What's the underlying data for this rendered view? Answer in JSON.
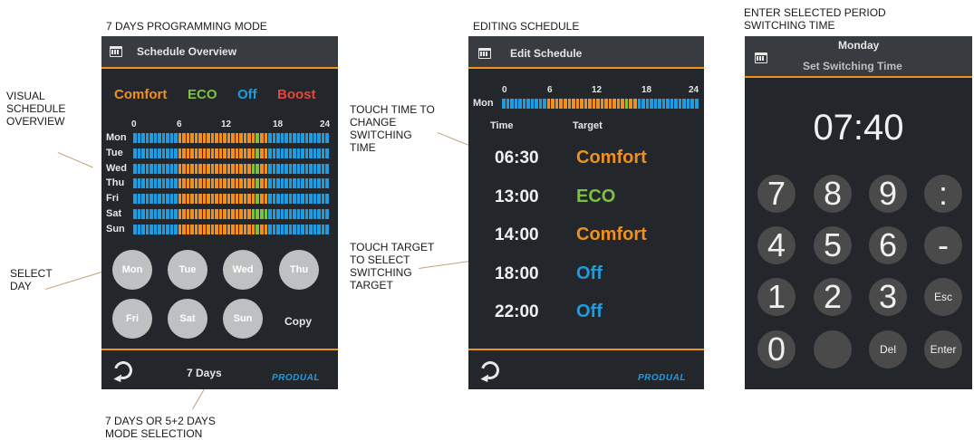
{
  "captions": {
    "mode_title": "7 DAYS PROGRAMMING MODE",
    "visual_overview": "VISUAL\nSCHEDULE\nOVERVIEW",
    "select_day": "SELECT\nDAY",
    "mode_selection": "7 DAYS OR 5+2 DAYS\nMODE SELECTION",
    "editing": "EDITING SCHEDULE",
    "touch_time": "TOUCH TIME TO\nCHANGE\nSWITCHING\nTIME",
    "touch_target": "TOUCH TARGET\nTO SELECT\nSWITCHING\nTARGET",
    "enter_period": "ENTER SELECTED PERIOD\nSWITCHING TIME"
  },
  "colors": {
    "comfort": "#f0901e",
    "eco": "#7cc242",
    "off": "#1e9ce0",
    "boost": "#e8443a"
  },
  "screen1": {
    "header_title": "Schedule Overview",
    "icon": "calendar-clock-icon",
    "legend": {
      "comfort": "Comfort",
      "eco": "ECO",
      "off": "Off",
      "boost": "Boost"
    },
    "hours": [
      "0",
      "6",
      "12",
      "18",
      "24"
    ],
    "days": [
      {
        "label": "Mon",
        "pattern": "OOOOOOOOOOOCCCCCCCCCCCCCCCCCCCCCCOOOOOOOOOOOOOOO"
      },
      {
        "label": "Tue",
        "pattern": "OOOOOOOOOOOCCCCCCCCCCCCCCCCCCCCCCOOOOOOOOOOOOOOO"
      },
      {
        "label": "Wed",
        "pattern": "OOOOOOOOOOOCCCCCCCCCCCCCCCCCCCCCCOOOOOOOOOOOOOOO"
      },
      {
        "label": "Thu",
        "pattern": "OOOOOOOOOOOCCCCCCCCCCCCCCCCCCCCCCOOOOOOOOOOOOOOO"
      },
      {
        "label": "Fri",
        "pattern": "OOOOOOOOOOOCCCCCCCCCCCCCCCCCCCCCCOOOOOOOOOOOOOOO"
      },
      {
        "label": "Sat",
        "pattern": "OOOOOOOOOOOCCCCCCCCCCCCCCCCCCCCCCOOOOOOOOOOOOOOO"
      },
      {
        "label": "Sun",
        "pattern": "OOOOOOOOOOOCCCCCCCCCCCCCCCCCCCCCCOOOOOOOOOOOOOOO"
      }
    ],
    "day_buttons": [
      "Mon",
      "Tue",
      "Wed",
      "Thu",
      "Fri",
      "Sat",
      "Sun"
    ],
    "copy_label": "Copy",
    "mode_label": "7 Days",
    "logo": "PRODUAL"
  },
  "screen2": {
    "header_title": "Edit Schedule",
    "hours": [
      "0",
      "6",
      "12",
      "18",
      "24"
    ],
    "day_label": "Mon",
    "col_time": "Time",
    "col_target": "Target",
    "rows": [
      {
        "time": "06:30",
        "target": "Comfort",
        "kind": "comfort"
      },
      {
        "time": "13:00",
        "target": "ECO",
        "kind": "eco"
      },
      {
        "time": "14:00",
        "target": "Comfort",
        "kind": "comfort"
      },
      {
        "time": "18:00",
        "target": "Off",
        "kind": "off"
      },
      {
        "time": "22:00",
        "target": "Off",
        "kind": "off"
      }
    ],
    "logo": "PRODUAL"
  },
  "screen3": {
    "day": "Monday",
    "subtitle": "Set Switching Time",
    "time_display": "07:40",
    "keys": [
      "7",
      "8",
      "9",
      ":",
      "4",
      "5",
      "6",
      "-",
      "1",
      "2",
      "3",
      "Esc",
      "0",
      "",
      "Del",
      "Enter"
    ]
  }
}
